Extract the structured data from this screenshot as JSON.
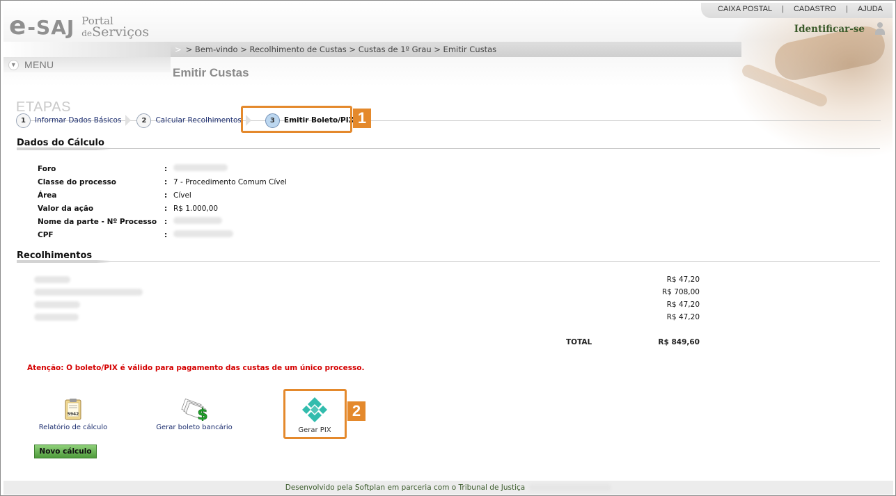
{
  "header": {
    "logo_e": "e",
    "logo_saj": "-SAJ",
    "logo_portal": "Portal",
    "logo_de": "de",
    "logo_servicos": "Serviços",
    "toplinks": [
      "CAIXA POSTAL",
      "CADASTRO",
      "AJUDA"
    ],
    "toplink_separator": "|",
    "identify": "Identificar-se"
  },
  "breadcrumb": {
    "arrow": ">",
    "text": "> Bem-vindo > Recolhimento de Custas > Custas de 1º Grau > Emitir Custas"
  },
  "menu": {
    "label": "MENU",
    "icon": "chevron-down-icon"
  },
  "page_title": "Emitir Custas",
  "steps": {
    "heading": "ETAPAS",
    "items": [
      {
        "num": "1",
        "label": "Informar Dados Básicos"
      },
      {
        "num": "2",
        "label": "Calcular Recolhimentos"
      },
      {
        "num": "3",
        "label": "Emitir Boleto/PIX"
      }
    ],
    "callout_1": "1",
    "callout_2": "2"
  },
  "dados": {
    "title": "Dados do Cálculo",
    "rows": [
      {
        "key": "Foro",
        "value": ""
      },
      {
        "key": "Classe do processo",
        "value": "7 - Procedimento Comum Cível"
      },
      {
        "key": "Área",
        "value": "Cível"
      },
      {
        "key": "Valor da ação",
        "value": "R$ 1.000,00"
      },
      {
        "key": "Nome da parte - Nº Processo",
        "value": ""
      },
      {
        "key": "CPF",
        "value": ""
      }
    ],
    "colon": ":"
  },
  "recolhimentos": {
    "title": "Recolhimentos",
    "values": [
      "R$ 47,20",
      "R$ 708,00",
      "R$ 47,20",
      "R$ 47,20"
    ],
    "total_label": "TOTAL",
    "total_value": "R$ 849,60"
  },
  "attention": "Atenção: O boleto/PIX é válido para pagamento das custas de um único processo.",
  "actions": {
    "relatorio": "Relatório de cálculo",
    "relatorio_badge": "5942",
    "boleto": "Gerar boleto bancário",
    "boleto_symbol": "$",
    "pix": "Gerar PIX"
  },
  "novo_calculo": "Novo cálculo",
  "footer": "Desenvolvido pela Softplan em parceria com o Tribunal de Justiça",
  "colors": {
    "callout": "#e4892c",
    "pix": "#32bcad",
    "attention": "#d40000",
    "button_green": "#4e9b3b"
  }
}
